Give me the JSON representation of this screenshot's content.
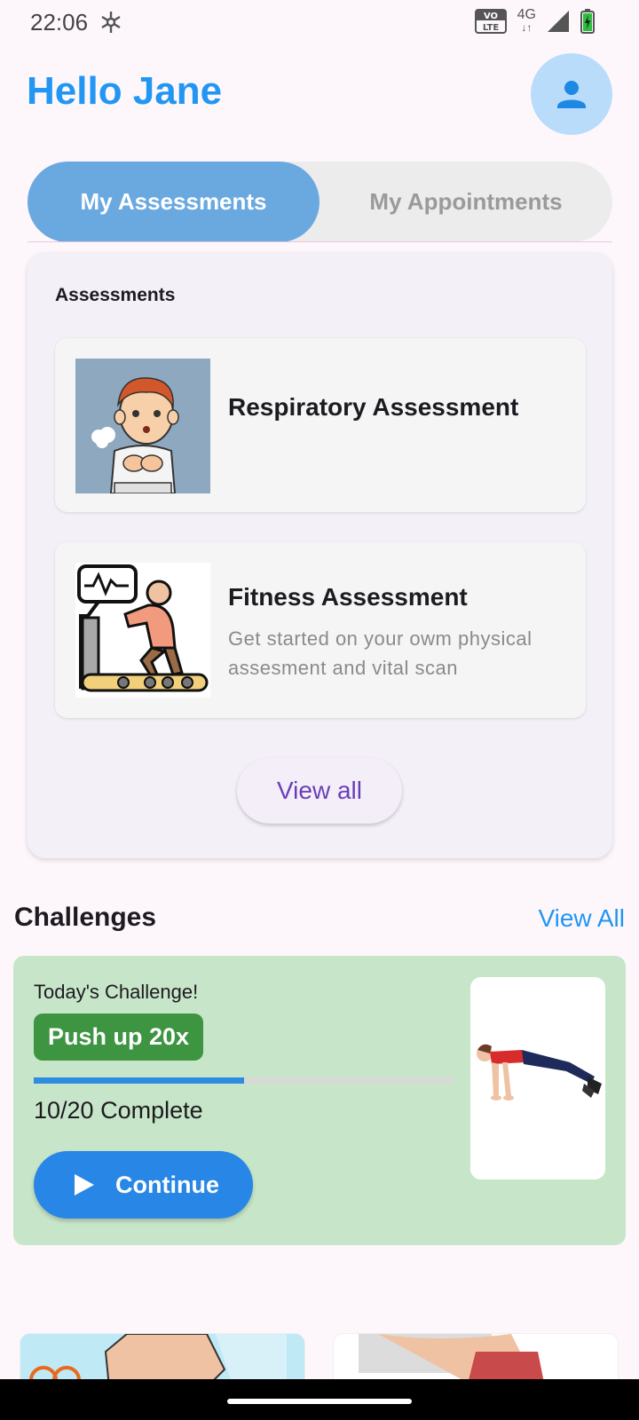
{
  "status_bar": {
    "time": "22:06",
    "volte_label": "VO\nLTE",
    "network_label": "4G"
  },
  "header": {
    "greeting": "Hello Jane",
    "accent_color": "#2196f3"
  },
  "tabs": [
    {
      "label": "My Assessments",
      "active": true
    },
    {
      "label": "My Appointments",
      "active": false
    }
  ],
  "assessments": {
    "heading": "Assessments",
    "items": [
      {
        "title": "Respiratory Assessment",
        "description": "",
        "icon": "respiratory-illustration"
      },
      {
        "title": "Fitness Assessment",
        "description": "Get started on your owm  physical assesment and vital scan",
        "icon": "treadmill-illustration"
      }
    ],
    "view_all_label": "View all"
  },
  "challenges": {
    "title": "Challenges",
    "view_all_label": "View All",
    "today": {
      "label": "Today's Challenge!",
      "name": "Push up 20x",
      "progress_text": "10/20 Complete",
      "progress_fraction": 0.5,
      "continue_label": "Continue",
      "image": "pushup-illustration"
    }
  }
}
